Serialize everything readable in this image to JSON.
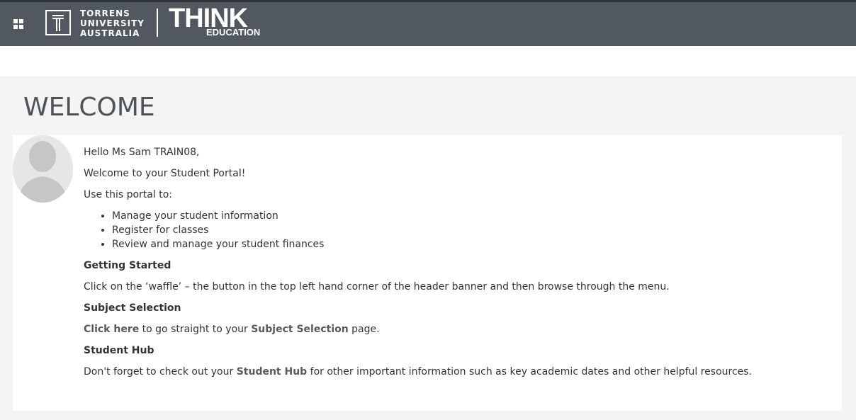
{
  "header": {
    "logo_lines": [
      "TORRENS",
      "UNIVERSITY",
      "AUSTRALIA"
    ],
    "think_text": "THINK",
    "education_text": "EDUCATION",
    "icons": [
      "waffle-icon",
      "tua-logo-icon"
    ],
    "background_color": "#525860"
  },
  "page": {
    "title": "WELCOME"
  },
  "welcome": {
    "greeting": "Hello Ms Sam TRAIN08,",
    "intro": "Welcome to your Student Portal!",
    "use_portal": "Use this portal to:",
    "bullets": [
      "Manage your student information",
      "Register for classes",
      "Review and manage your student finances"
    ],
    "getting_started_heading": "Getting Started",
    "getting_started_text": "Click on the ‘waffle’ – the button in the top left hand corner of the header banner and then browse through the menu.",
    "subject_selection_heading": "Subject Selection",
    "click_here_link": "Click here",
    "subject_text_1": " to go straight to your ",
    "subject_selection_link": "Subject Selection",
    "subject_text_2": " page.",
    "student_hub_heading": "Student Hub",
    "hub_text_1": "Don't forget to check out your ",
    "student_hub_link": "Student Hub",
    "hub_text_2": " for other important information such as key academic dates and other helpful resources."
  }
}
